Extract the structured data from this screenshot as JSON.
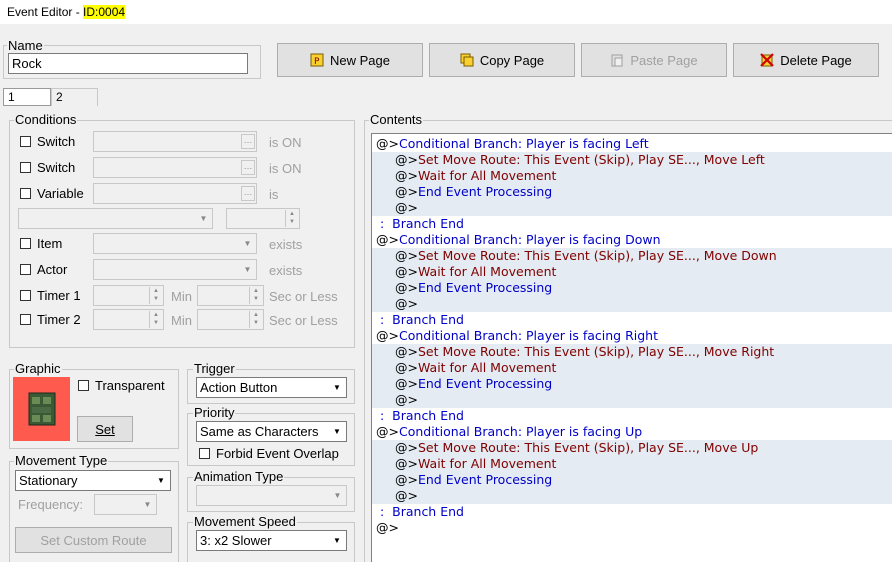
{
  "window": {
    "title": "Event Editor - ",
    "id_label": "ID:0004"
  },
  "name": {
    "label": "Name",
    "value": "Rock"
  },
  "toolbar": {
    "new_page": "New Page",
    "copy_page": "Copy Page",
    "paste_page": "Paste Page",
    "delete_page": "Delete Page"
  },
  "tabs": [
    "1",
    "2"
  ],
  "conditions": {
    "label": "Conditions",
    "switch1": "Switch",
    "switch2": "Switch",
    "variable": "Variable",
    "item": "Item",
    "actor": "Actor",
    "timer1": "Timer 1",
    "timer2": "Timer 2",
    "is_on": "is ON",
    "is": "is",
    "exists": "exists",
    "min": "Min",
    "sec_or_less": "Sec or Less"
  },
  "graphic": {
    "label": "Graphic",
    "transparent": "Transparent",
    "set": "Set",
    "bg_color": "#ff5a4e"
  },
  "movement_type": {
    "label": "Movement Type",
    "value": "Stationary",
    "frequency": "Frequency:",
    "custom_route": "Set Custom Route"
  },
  "trigger": {
    "label": "Trigger",
    "value": "Action Button"
  },
  "priority": {
    "label": "Priority",
    "value": "Same as Characters",
    "forbid_overlap": "Forbid Event Overlap"
  },
  "animation_type": {
    "label": "Animation Type"
  },
  "movement_speed": {
    "label": "Movement Speed",
    "value": "3: x2 Slower"
  },
  "contents": {
    "label": "Contents",
    "lines": [
      {
        "indent": 0,
        "prefix": "@>",
        "text": "Conditional Branch: Player is facing Left",
        "color": "kw",
        "shade": false
      },
      {
        "indent": 1,
        "prefix": "@>",
        "text": "Set Move Route: This Event (Skip), Play SE..., Move Left",
        "color": "mr",
        "shade": true
      },
      {
        "indent": 1,
        "prefix": "@>",
        "text": "Wait for All Movement",
        "color": "mr",
        "shade": true
      },
      {
        "indent": 1,
        "prefix": "@>",
        "text": "End Event Processing",
        "color": "kw",
        "shade": true
      },
      {
        "indent": 1,
        "prefix": "@>",
        "text": "",
        "color": "kw",
        "shade": true
      },
      {
        "indent": 0,
        "prefix": " :  ",
        "text": "Branch End",
        "color": "kw",
        "shade": false
      },
      {
        "indent": 0,
        "prefix": "@>",
        "text": "Conditional Branch: Player is facing Down",
        "color": "kw",
        "shade": false
      },
      {
        "indent": 1,
        "prefix": "@>",
        "text": "Set Move Route: This Event (Skip), Play SE..., Move Down",
        "color": "mr",
        "shade": true
      },
      {
        "indent": 1,
        "prefix": "@>",
        "text": "Wait for All Movement",
        "color": "mr",
        "shade": true
      },
      {
        "indent": 1,
        "prefix": "@>",
        "text": "End Event Processing",
        "color": "kw",
        "shade": true
      },
      {
        "indent": 1,
        "prefix": "@>",
        "text": "",
        "color": "kw",
        "shade": true
      },
      {
        "indent": 0,
        "prefix": " :  ",
        "text": "Branch End",
        "color": "kw",
        "shade": false
      },
      {
        "indent": 0,
        "prefix": "@>",
        "text": "Conditional Branch: Player is facing Right",
        "color": "kw",
        "shade": false
      },
      {
        "indent": 1,
        "prefix": "@>",
        "text": "Set Move Route: This Event (Skip), Play SE..., Move Right",
        "color": "mr",
        "shade": true
      },
      {
        "indent": 1,
        "prefix": "@>",
        "text": "Wait for All Movement",
        "color": "mr",
        "shade": true
      },
      {
        "indent": 1,
        "prefix": "@>",
        "text": "End Event Processing",
        "color": "kw",
        "shade": true
      },
      {
        "indent": 1,
        "prefix": "@>",
        "text": "",
        "color": "kw",
        "shade": true
      },
      {
        "indent": 0,
        "prefix": " :  ",
        "text": "Branch End",
        "color": "kw",
        "shade": false
      },
      {
        "indent": 0,
        "prefix": "@>",
        "text": "Conditional Branch: Player is facing Up",
        "color": "kw",
        "shade": false
      },
      {
        "indent": 1,
        "prefix": "@>",
        "text": "Set Move Route: This Event (Skip), Play SE..., Move Up",
        "color": "mr",
        "shade": true
      },
      {
        "indent": 1,
        "prefix": "@>",
        "text": "Wait for All Movement",
        "color": "mr",
        "shade": true
      },
      {
        "indent": 1,
        "prefix": "@>",
        "text": "End Event Processing",
        "color": "kw",
        "shade": true
      },
      {
        "indent": 1,
        "prefix": "@>",
        "text": "",
        "color": "kw",
        "shade": true
      },
      {
        "indent": 0,
        "prefix": " :  ",
        "text": "Branch End",
        "color": "kw",
        "shade": false
      },
      {
        "indent": 0,
        "prefix": "@>",
        "text": "",
        "color": "kw",
        "shade": false
      }
    ]
  }
}
